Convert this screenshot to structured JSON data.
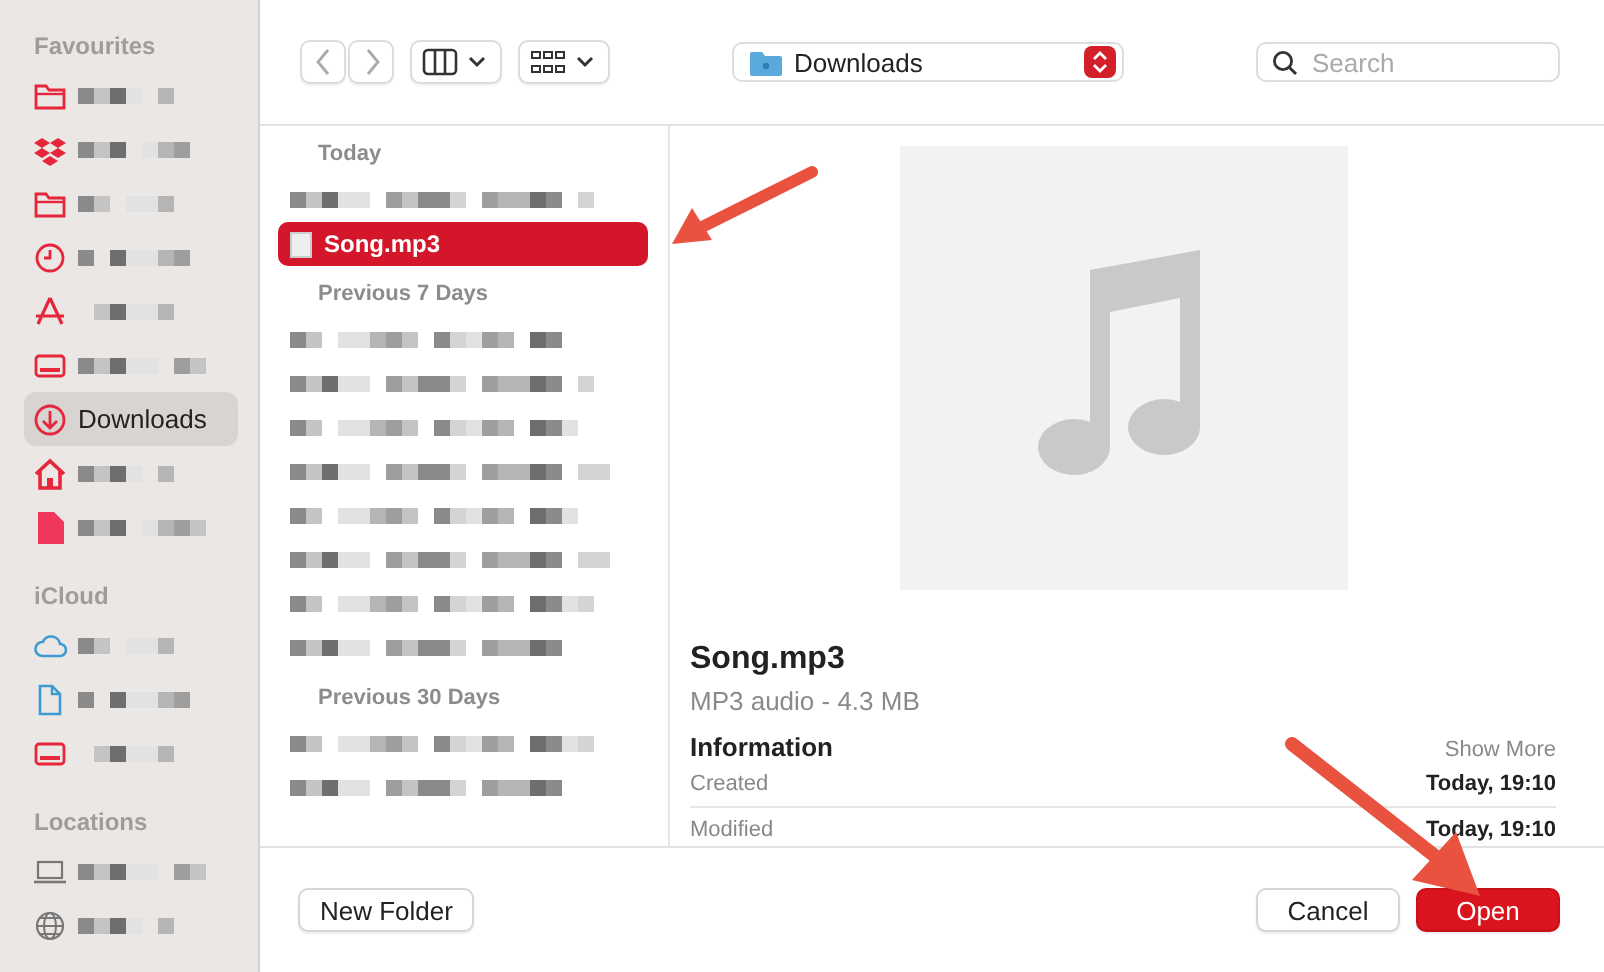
{
  "sidebar": {
    "sections": [
      {
        "title": "Favourites",
        "items": [
          {
            "kind": "folder",
            "redacted": true,
            "selected": false
          },
          {
            "kind": "boxes",
            "redacted": true,
            "selected": false
          },
          {
            "kind": "folder",
            "redacted": true,
            "selected": false
          },
          {
            "kind": "clock",
            "redacted": true,
            "selected": false
          },
          {
            "kind": "apps",
            "redacted": true,
            "selected": false
          },
          {
            "kind": "drive",
            "redacted": true,
            "selected": false
          },
          {
            "kind": "download",
            "label": "Downloads",
            "redacted": false,
            "selected": true
          },
          {
            "kind": "home",
            "redacted": true,
            "selected": false
          },
          {
            "kind": "document",
            "redacted": true,
            "selected": false
          }
        ]
      },
      {
        "title": "iCloud",
        "items": [
          {
            "kind": "cloud",
            "redacted": true,
            "selected": false
          },
          {
            "kind": "page",
            "redacted": true,
            "selected": false
          },
          {
            "kind": "drive",
            "redacted": true,
            "selected": false
          }
        ]
      },
      {
        "title": "Locations",
        "items": [
          {
            "kind": "laptop",
            "redacted": true,
            "selected": false
          },
          {
            "kind": "globe",
            "redacted": true,
            "selected": false
          }
        ]
      }
    ]
  },
  "toolbar": {
    "location": "Downloads",
    "search": {
      "placeholder": "Search"
    }
  },
  "file_list": {
    "groups": [
      {
        "title": "Today",
        "files": [
          {
            "redacted": true,
            "selected": false
          },
          {
            "name": "Song.mp3",
            "redacted": false,
            "selected": true
          }
        ]
      },
      {
        "title": "Previous 7 Days",
        "files": [
          {
            "redacted": true,
            "selected": false
          },
          {
            "redacted": true,
            "selected": false
          },
          {
            "redacted": true,
            "selected": false
          },
          {
            "redacted": true,
            "selected": false
          },
          {
            "redacted": true,
            "selected": false
          },
          {
            "redacted": true,
            "selected": false
          },
          {
            "redacted": true,
            "selected": false
          },
          {
            "redacted": true,
            "selected": false
          }
        ]
      },
      {
        "title": "Previous 30 Days",
        "files": [
          {
            "redacted": true,
            "selected": false
          },
          {
            "redacted": true,
            "selected": false
          }
        ]
      }
    ]
  },
  "preview": {
    "name": "Song.mp3",
    "subtitle": "MP3 audio - 4.3 MB",
    "info_title": "Information",
    "show_more": "Show More",
    "rows": [
      {
        "label": "Created",
        "value": "Today, 19:10"
      },
      {
        "label": "Modified",
        "value": "Today, 19:10"
      }
    ]
  },
  "buttons": {
    "new_folder": "New Folder",
    "cancel": "Cancel",
    "open": "Open"
  }
}
